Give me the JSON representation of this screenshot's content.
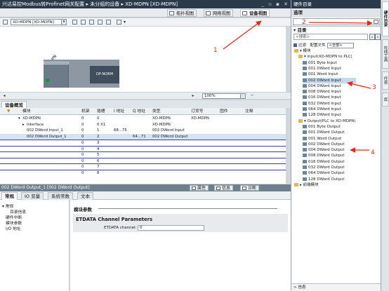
{
  "breadcrumb": {
    "path": "兴达易控Modbus转Profinet网关配置 ▸ 未分组的设备 ▸ XD-MDPN [XD-MDPN]"
  },
  "view_tabs": [
    "拓扑视图",
    "网络视图",
    "设备视图"
  ],
  "device_toolbar": {
    "device_select": "XD-MDPN [XD-MDPN]"
  },
  "canvas": {
    "rack_label": "XD-MDPN",
    "module_label": "DP-NORM",
    "zoom": "100%"
  },
  "overview": {
    "tab": "设备概览",
    "columns": [
      "模块",
      "机架",
      "插槽",
      "I 地址",
      "Q 地址",
      "类型",
      "订货号",
      "固件",
      "注释"
    ],
    "rows": [
      {
        "module": "XD-MDPN",
        "rack": "0",
        "slot": "0",
        "i": "",
        "q": "",
        "type": "XD-MDPN",
        "order": "XD-MDPN",
        "indent": 1,
        "expand": "▾"
      },
      {
        "module": "Interface",
        "rack": "0",
        "slot": "0 X1",
        "i": "",
        "q": "",
        "type": "XD-MDPN",
        "order": "",
        "indent": 2,
        "expand": "▸"
      },
      {
        "module": "002 DWord Input_1",
        "rack": "0",
        "slot": "1",
        "i": "68...75",
        "q": "",
        "type": "002 DWord Input",
        "order": "",
        "indent": 2,
        "expand": ""
      },
      {
        "module": "002 DWord Output_1",
        "rack": "0",
        "slot": "2",
        "i": "",
        "q": "64...71",
        "type": "002 DWord Output",
        "order": "",
        "indent": 2,
        "expand": ""
      },
      {
        "module": "",
        "rack": "0",
        "slot": "3",
        "i": "",
        "q": "",
        "type": "",
        "order": "",
        "indent": 2,
        "expand": ""
      },
      {
        "module": "",
        "rack": "0",
        "slot": "4",
        "i": "",
        "q": "",
        "type": "",
        "order": "",
        "indent": 2,
        "expand": ""
      },
      {
        "module": "",
        "rack": "0",
        "slot": "5",
        "i": "",
        "q": "",
        "type": "",
        "order": "",
        "indent": 2,
        "expand": ""
      },
      {
        "module": "",
        "rack": "0",
        "slot": "6",
        "i": "",
        "q": "",
        "type": "",
        "order": "",
        "indent": 2,
        "expand": ""
      },
      {
        "module": "",
        "rack": "0",
        "slot": "7",
        "i": "",
        "q": "",
        "type": "",
        "order": "",
        "indent": 2,
        "expand": ""
      },
      {
        "module": "",
        "rack": "0",
        "slot": "8",
        "i": "",
        "q": "",
        "type": "",
        "order": "",
        "indent": 2,
        "expand": ""
      }
    ]
  },
  "properties": {
    "header_title": "002 DWord Output_1 [002 DWord Output]",
    "header_tabs": [
      "属性",
      "信息",
      "诊断"
    ],
    "subtabs": [
      "常规",
      "IO 变量",
      "系统常数",
      "文本"
    ],
    "tree": [
      "▾ 常规",
      "目录信息",
      "硬件中断",
      "模块参数",
      "I/O 地址"
    ],
    "section": "模块参数",
    "panel_title": "ETDATA Channel Parameters",
    "field_label": "ETDATA channel:",
    "field_value": "0"
  },
  "catalog": {
    "title": "硬件目录",
    "options": "选项",
    "directory": "▾ 目录",
    "search_placeholder": "<搜索>",
    "filter_label": "过滤",
    "profile_label": "配置文件",
    "profile_value": "<全部>",
    "items": [
      {
        "text": "▾ 模块",
        "indent": 0,
        "icon": "folder"
      },
      {
        "text": "▾ Input(XD-MDPN to PLC)",
        "indent": 1,
        "icon": "folder"
      },
      {
        "text": "001 Byte Input",
        "indent": 2,
        "icon": "module"
      },
      {
        "text": "001 DWord Input",
        "indent": 2,
        "icon": "module"
      },
      {
        "text": "001 Word Input",
        "indent": 2,
        "icon": "module"
      },
      {
        "text": "002 DWord Input",
        "indent": 2,
        "icon": "module",
        "selected": true
      },
      {
        "text": "004 DWord Input",
        "indent": 2,
        "icon": "module"
      },
      {
        "text": "008 DWord Input",
        "indent": 2,
        "icon": "module"
      },
      {
        "text": "016 DWord Input",
        "indent": 2,
        "icon": "module"
      },
      {
        "text": "032 DWord Input",
        "indent": 2,
        "icon": "module"
      },
      {
        "text": "064 DWord Input",
        "indent": 2,
        "icon": "module"
      },
      {
        "text": "128 DWord Input",
        "indent": 2,
        "icon": "module"
      },
      {
        "text": "▾ Output(PLC to XD-MDPN)",
        "indent": 1,
        "icon": "folder"
      },
      {
        "text": "001 Byte Output",
        "indent": 2,
        "icon": "module"
      },
      {
        "text": "001 DWord Output",
        "indent": 2,
        "icon": "module"
      },
      {
        "text": "001 Word Output",
        "indent": 2,
        "icon": "module"
      },
      {
        "text": "002 DWord Output",
        "indent": 2,
        "icon": "module"
      },
      {
        "text": "004 DWord Output",
        "indent": 2,
        "icon": "module"
      },
      {
        "text": "008 DWord Output",
        "indent": 2,
        "icon": "module"
      },
      {
        "text": "016 DWord Output",
        "indent": 2,
        "icon": "module"
      },
      {
        "text": "032 DWord Output",
        "indent": 2,
        "icon": "module"
      },
      {
        "text": "064 DWord Output",
        "indent": 2,
        "icon": "module"
      },
      {
        "text": "128 DWord Output",
        "indent": 2,
        "icon": "module"
      },
      {
        "text": "▸ 前端模块",
        "indent": 0,
        "icon": "folder"
      }
    ],
    "info": "> 信息"
  },
  "side_tabs": [
    "硬件目录",
    "在线工具",
    "任务",
    "库"
  ],
  "annotations": [
    "1",
    "2",
    "3",
    "4"
  ],
  "colors": {
    "annotation": "#e02a1a",
    "title_bar": "#2b3a4a",
    "selection": "#c4d8ee"
  }
}
